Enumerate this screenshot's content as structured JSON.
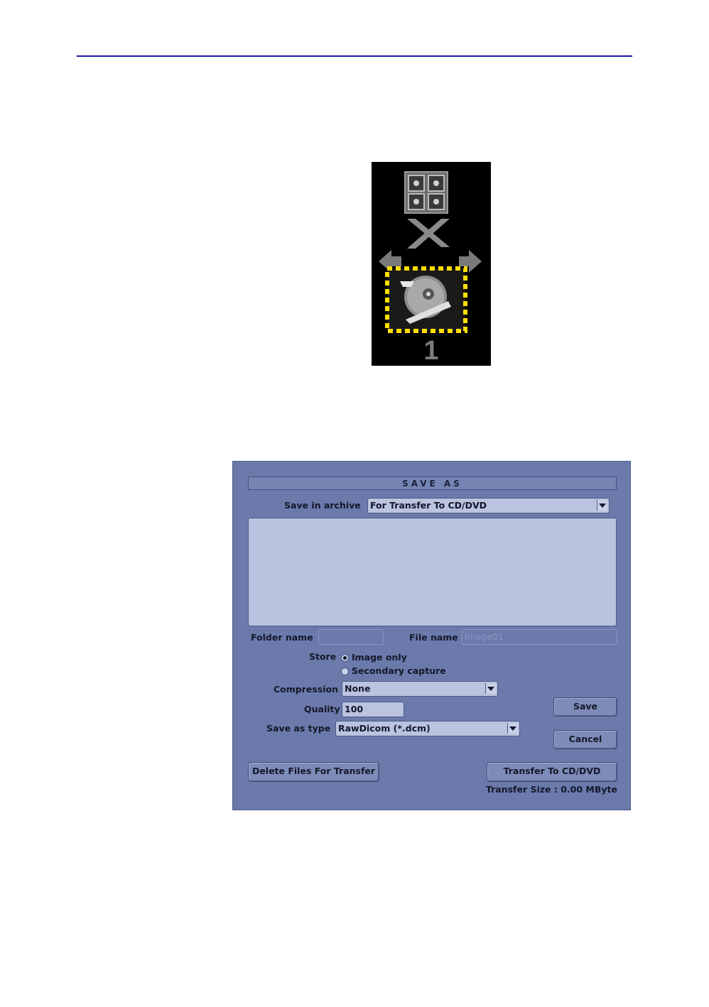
{
  "icon_panel": {
    "counter": "1"
  },
  "dialog": {
    "title": "SAVE AS",
    "save_in_archive_label": "Save in archive",
    "save_in_archive_value": "For Transfer To CD/DVD",
    "folder_name_label": "Folder name",
    "folder_name_value": "",
    "file_name_label": "File name",
    "file_name_value": "Image01",
    "store_label": "Store",
    "store_options": [
      "Image only",
      "Secondary capture"
    ],
    "store_selected": "Image only",
    "compression_label": "Compression",
    "compression_value": "None",
    "quality_label": "Quality",
    "quality_value": "100",
    "save_as_type_label": "Save as type",
    "save_as_type_value": "RawDicom  (*.dcm)",
    "save_button": "Save",
    "cancel_button": "Cancel",
    "delete_button": "Delete Files For Transfer",
    "transfer_button": "Transfer To CD/DVD",
    "transfer_size": "Transfer Size : 0.00 MByte"
  }
}
